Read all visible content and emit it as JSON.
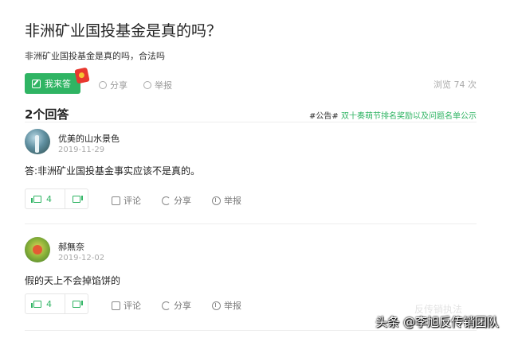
{
  "question": {
    "title": "非洲矿业国投基金是真的吗？",
    "description": "非洲矿业国投基金是真的吗，合法吗",
    "answer_button": "我来答",
    "share": "分享",
    "report": "举报",
    "views": "浏览 74 次"
  },
  "answers_header": {
    "count_label": "2个回答",
    "notice_tag": "#公告#",
    "notice_text": "双十奏萌节排名奖励以及问题名单公示"
  },
  "answers": [
    {
      "user": "优美的山水景色",
      "date": "2019-11-29",
      "text": "答:非洲矿业国投基金事实应该不是真的。",
      "likes": "4",
      "comment": "评论",
      "share": "分享",
      "report": "举报"
    },
    {
      "user": "郝無奈",
      "date": "2019-12-02",
      "text": "假的天上不会掉馅饼的",
      "likes": "4",
      "comment": "评论",
      "share": "分享",
      "report": "举报"
    }
  ],
  "watermark": {
    "text": "头条 @李旭反传销团队",
    "faint": "反传销执法"
  },
  "colors": {
    "accent": "#2fb463",
    "red_packet": "#e8382f"
  }
}
